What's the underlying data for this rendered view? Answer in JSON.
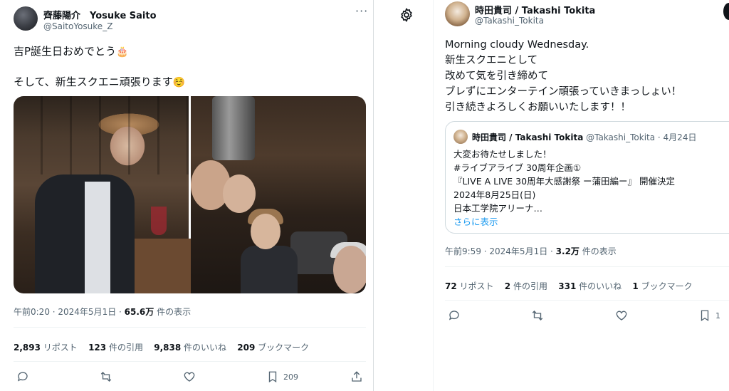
{
  "left_tweet": {
    "author_name": "齊藤陽介　Yosuke Saito",
    "author_handle": "@SaitoYosuke_Z",
    "more_label": "···",
    "text_line1": "吉P誕生日おめでとう",
    "text_line1_emoji": "🎂",
    "text_line2": "そして、新生スクエニ頑張ります",
    "text_line2_emoji": "☺️",
    "time": "午前0:20 · 2024年5月1日 · ",
    "views_count": "65.6万",
    "views_label": " 件の表示",
    "stats": {
      "reposts_count": "2,893",
      "reposts_label": " リポスト",
      "quotes_count": "123",
      "quotes_label": " 件の引用",
      "likes_count": "9,838",
      "likes_label": " 件のいいね",
      "bookmarks_count": "209",
      "bookmarks_label": " ブックマーク"
    },
    "actions": {
      "bookmark_count": "209"
    }
  },
  "right_tweet": {
    "author_name": "時田貴司 / Takashi Tokita",
    "author_handle": "@Takashi_Tokita",
    "text_lines": [
      "Morning cloudy Wednesday.",
      "新生スクエニとして",
      "改めて気を引き締めて",
      "ブレずにエンターテイン頑張っていきまっしょい！",
      "引き続きよろしくお願いいたします！！"
    ],
    "quote": {
      "author_name": "時田貴司 / Takashi Tokita",
      "author_handle": "@Takashi_Tokita",
      "date": "· 4月24日",
      "lines": [
        "大変お待たせしました！",
        "#ライブアライブ 30周年企画①",
        "『LIVE A LIVE 30周年大感謝祭 ー蒲田編ー』 開催決定",
        "2024年8月25日(日)",
        "日本工学院アリーナ…"
      ],
      "show_more": "さらに表示"
    },
    "time": "午前9:59 · 2024年5月1日 · ",
    "views_count": "3.2万",
    "views_label": " 件の表示",
    "stats": {
      "reposts_count": "72",
      "reposts_label": " リポスト",
      "quotes_count": "2",
      "quotes_label": " 件の引用",
      "likes_count": "331",
      "likes_label": " 件のいいね",
      "bookmarks_count": "1",
      "bookmarks_label": " ブックマーク"
    },
    "actions": {
      "bookmark_count": "1"
    }
  },
  "colors": {
    "text": "#0f1419",
    "muted": "#536471",
    "link": "#1d9bf0",
    "border": "#cfd9de"
  }
}
